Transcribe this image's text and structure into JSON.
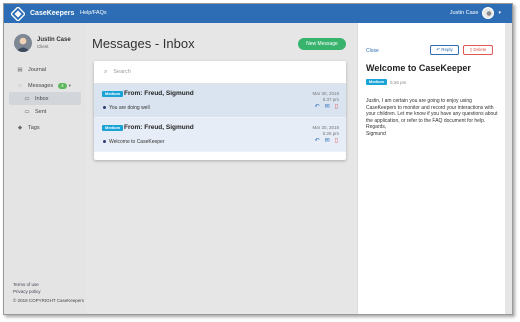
{
  "app": {
    "name": "CaseKeepers",
    "nav_help": "Help/FAQs",
    "user_name": "Justin Case"
  },
  "sidebar": {
    "profile": {
      "name": "Justin Case",
      "role": "Client"
    },
    "items": [
      {
        "label": "Journal",
        "icon": "book-icon"
      },
      {
        "label": "Messages",
        "icon": "chat-icon",
        "badge": "4"
      },
      {
        "label": "Inbox",
        "icon": "inbox-icon"
      },
      {
        "label": "Sent",
        "icon": "sent-icon"
      },
      {
        "label": "Tags",
        "icon": "tag-icon"
      }
    ],
    "footer": {
      "terms": "Terms of use",
      "privacy": "Privacy policy",
      "copyright": "© 2018 COPYRIGHT CaseKeepers"
    }
  },
  "main": {
    "title": "Messages - Inbox",
    "new_message": "New Message",
    "search_placeholder": "Search",
    "messages": [
      {
        "priority": "Medium",
        "from": "From: Freud, Sigmund",
        "date": "Mar 30, 2018",
        "time": "5:37 pm",
        "subject": "You are doing well"
      },
      {
        "priority": "Medium",
        "from": "From: Freud, Sigmund",
        "date": "Mar 30, 2018",
        "time": "5:26 pm",
        "subject": "Welcome to CaseKeeper"
      }
    ]
  },
  "detail": {
    "close": "Close",
    "reply": "Reply",
    "delete": "Delete",
    "title": "Welcome to CaseKeeper",
    "priority": "Medium",
    "time": "5:26 pm",
    "body": "Justin, I am certain you are going to enjoy using CaseKeepers to monitor and record your interactions with your children. Let me know if you have any questions about the application, or refer to the FAQ document for help.",
    "regards": "Regards,",
    "signature": "Sigmund"
  },
  "colors": {
    "brand": "#2c6db5",
    "new_message": "#38b36e",
    "priority": "#1aa3d6",
    "delete": "#e05555"
  }
}
